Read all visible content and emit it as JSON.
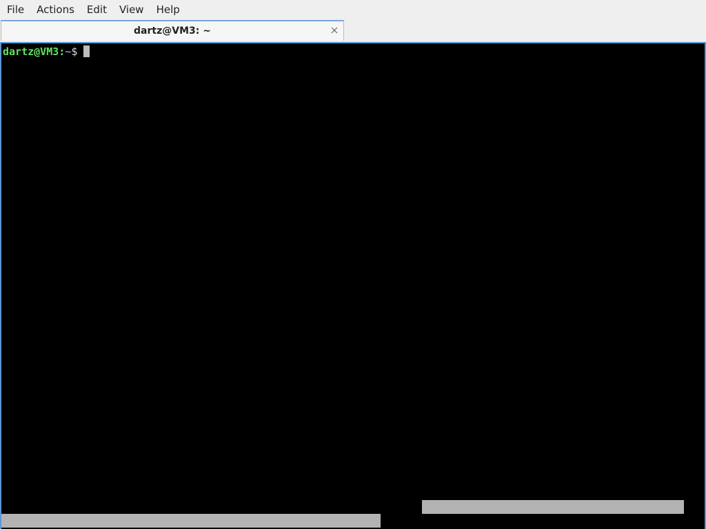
{
  "menubar": {
    "items": [
      "File",
      "Actions",
      "Edit",
      "View",
      "Help"
    ]
  },
  "tab": {
    "title": "dartz@VM3: ~",
    "close_icon": "close-icon"
  },
  "terminal": {
    "prompt_user_host": "dartz@VM3:",
    "prompt_path": "~",
    "prompt_symbol": "$"
  },
  "colors": {
    "terminal_bg": "#000000",
    "prompt_user": "#5fe35f",
    "prompt_path": "#7f8cf0",
    "active_border": "#5b96d6"
  }
}
